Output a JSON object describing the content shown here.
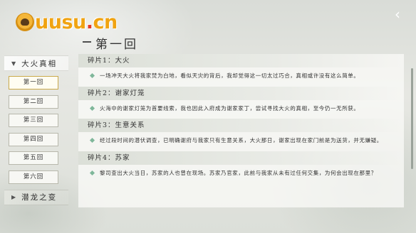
{
  "logo": {
    "text_main": "uusu",
    "text_dot": ".",
    "text_tld": "cn"
  },
  "header": {
    "back_icon": "back-arrow-icon",
    "back_glyph": "‹",
    "chapter_title": "第一回"
  },
  "sidebar": {
    "categories": [
      {
        "label": "大火真相",
        "expanded": true
      },
      {
        "label": "潜龙之变",
        "expanded": false
      }
    ],
    "items": [
      "第一回",
      "第二回",
      "第三回",
      "第四回",
      "第五回",
      "第六回"
    ],
    "active_index": 0
  },
  "fragments": [
    {
      "title": "碎片1：大火",
      "text": "一场冲天大火将我家焚为白地，看似天灾的背后，我却觉得这一切太过巧合，真相或许没有这么简单。"
    },
    {
      "title": "碎片2：谢家灯笼",
      "text": "火海中的谢家灯笼为首要线索，我也因此入府成为谢家家丁，尝试寻找大火的真相，至今仍一无所获。"
    },
    {
      "title": "碎片3：生意关系",
      "text": "经过段时间的潜伏调查，已明确谢府与我家只有生意关系，大火那日，谢家出现在家门前是为送货，并无嫌疑。"
    },
    {
      "title": "碎片4：苏家",
      "text": "黎司查出大火当日，苏家的人也曾在现场。苏家乃官家，此前与我家从未有过任何交集，为何会出现在那里？"
    }
  ]
}
